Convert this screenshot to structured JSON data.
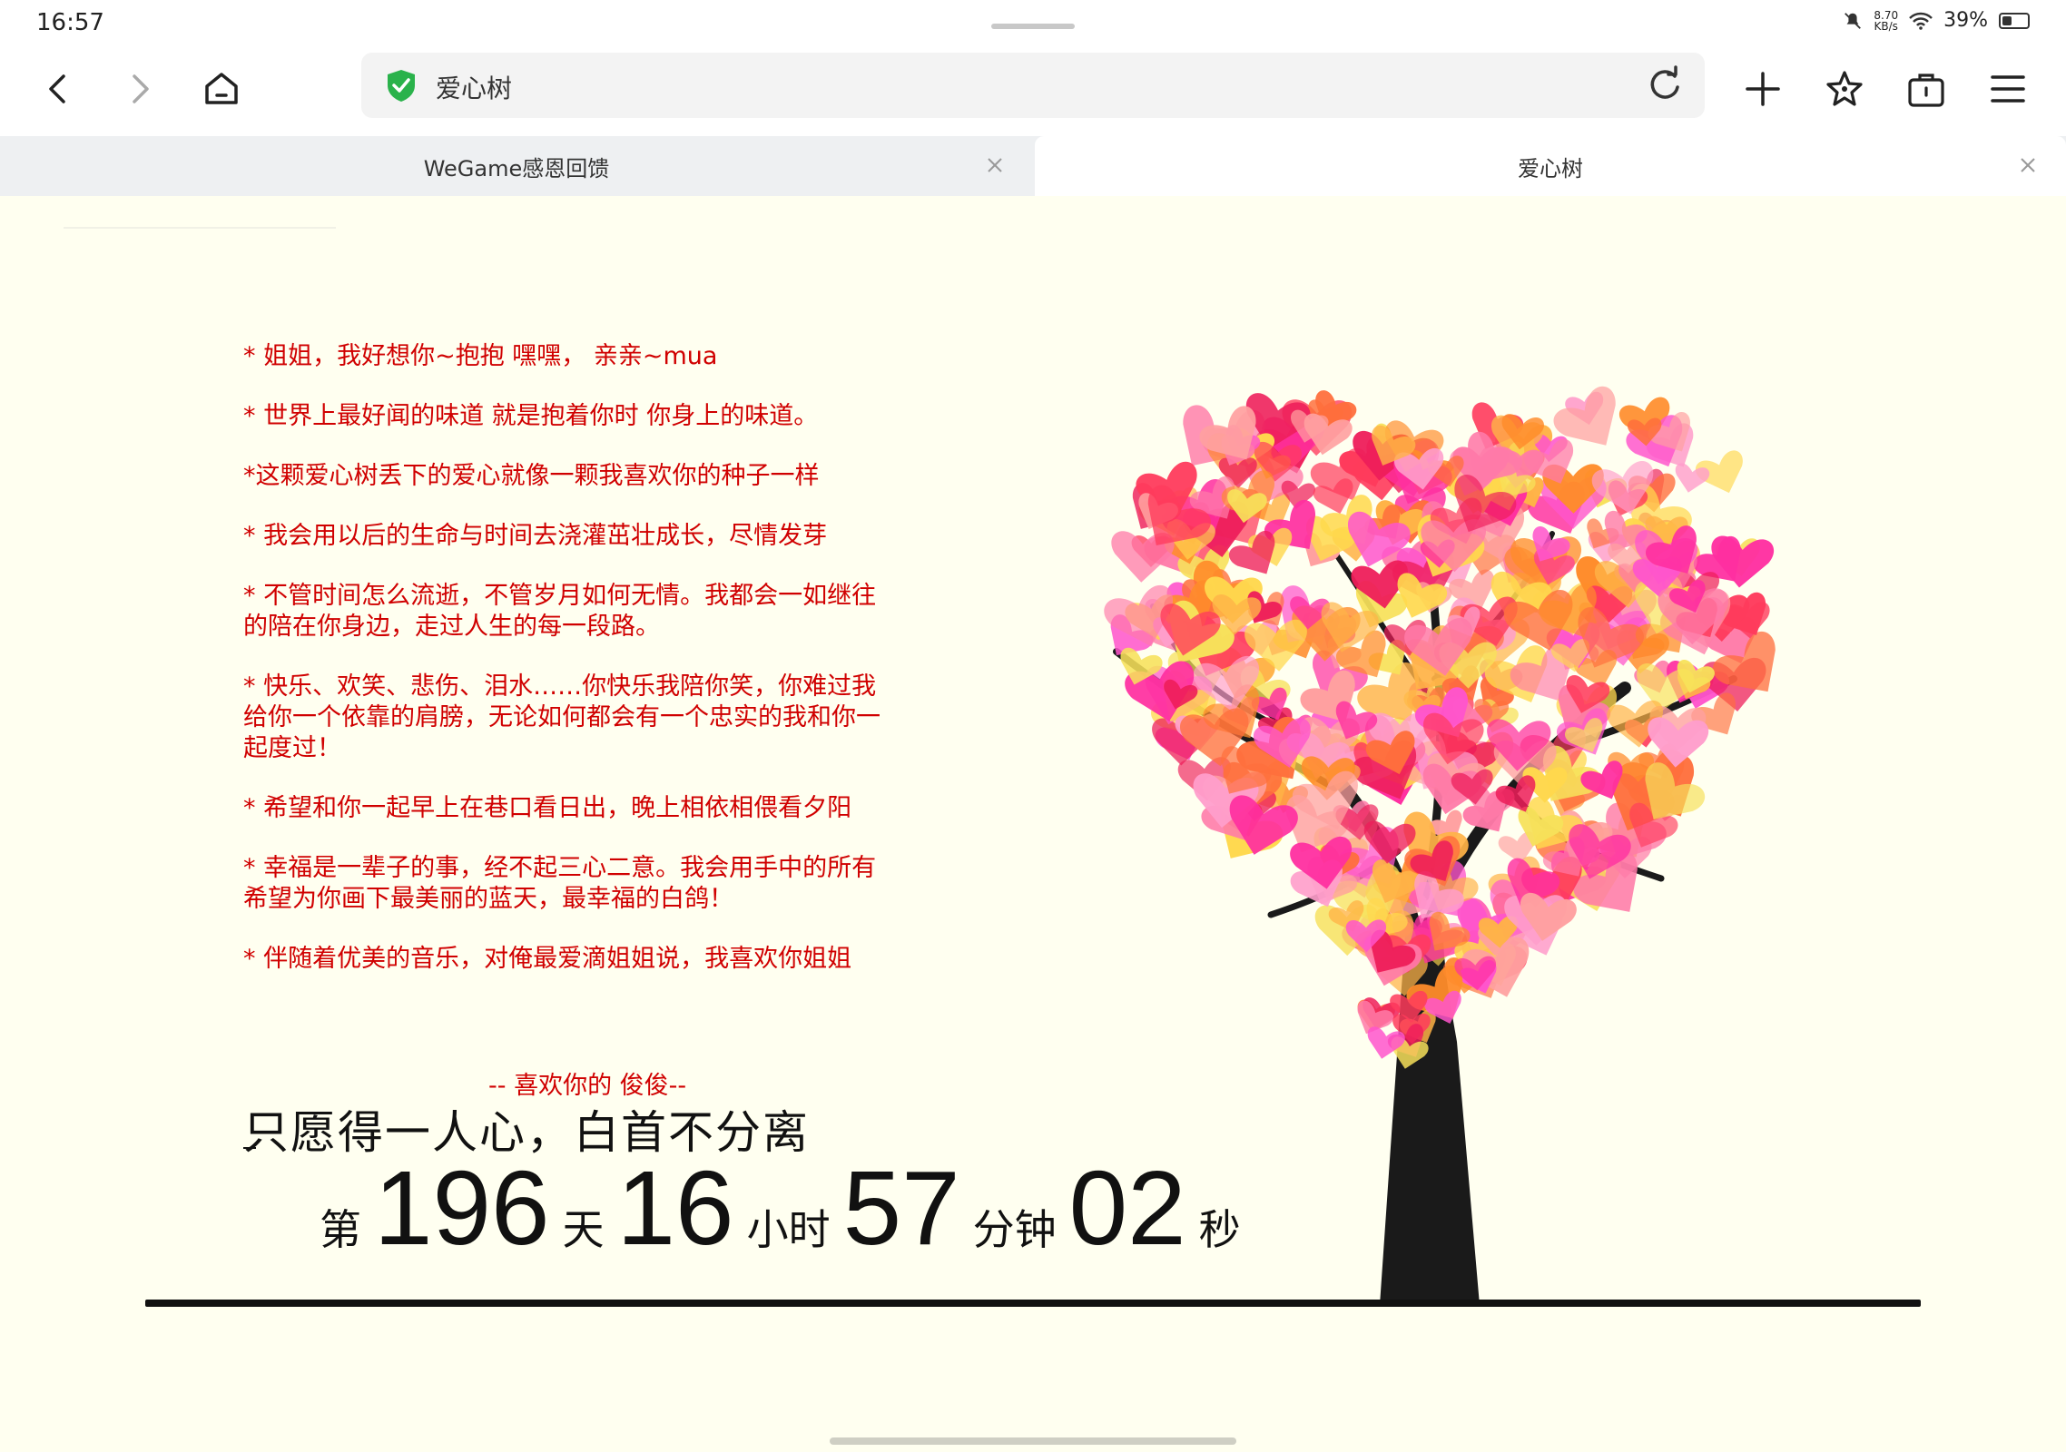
{
  "status": {
    "time": "16:57",
    "net_speed_value": "8.70",
    "net_speed_unit": "KB/s",
    "battery": "39%",
    "battery_level": 0.39
  },
  "toolbar": {
    "back_icon": "chevron-left-icon",
    "forward_icon": "chevron-right-icon",
    "home_icon": "home-icon",
    "new_tab_icon": "plus-icon",
    "bookmark_icon": "star-icon",
    "tabs_icon": "bag-icon",
    "menu_icon": "menu-icon"
  },
  "address": {
    "text": "爱心树",
    "security_icon": "shield-check-icon",
    "security_color": "#2ab24b"
  },
  "tabs": [
    {
      "label": "WeGame感恩回馈",
      "active": false
    },
    {
      "label": "爱心树",
      "active": true
    }
  ],
  "page": {
    "messages": [
      "* 姐姐，我好想你~抱抱 嘿嘿， 亲亲~mua",
      "* 世界上最好闻的味道 就是抱着你时 你身上的味道。",
      "*这颗爱心树丢下的爱心就像一颗我喜欢你的种子一样",
      "* 我会用以后的生命与时间去浇灌茁壮成长，尽情发芽",
      "* 不管时间怎么流逝，不管岁月如何无情。我都会一如继往的陪在你身边，走过人生的每一段路。",
      "* 快乐、欢笑、悲伤、泪水……你快乐我陪你笑，你难过我给你一个依靠的肩膀，无论如何都会有一个忠实的我和你一起度过！",
      "* 希望和你一起早上在巷口看日出，晚上相依相偎看夕阳",
      "* 幸福是一辈子的事，经不起三心二意。我会用手中的所有希望为你画下最美丽的蓝天，最幸福的白鸽！",
      "* 伴随着优美的音乐，对俺最爱滴姐姐说，我喜欢你姐姐"
    ],
    "signature": "-- 喜欢你的 俊俊--",
    "tagline": "只愿得一人心，白首不分离",
    "counter": {
      "prefix": "第",
      "days": "196",
      "days_unit": "天",
      "hours": "16",
      "hours_unit": "小时",
      "minutes": "57",
      "minutes_unit": "分钟",
      "seconds": "02",
      "seconds_unit": "秒"
    },
    "text_color": "#d00000",
    "background_color": "#fffff0"
  }
}
